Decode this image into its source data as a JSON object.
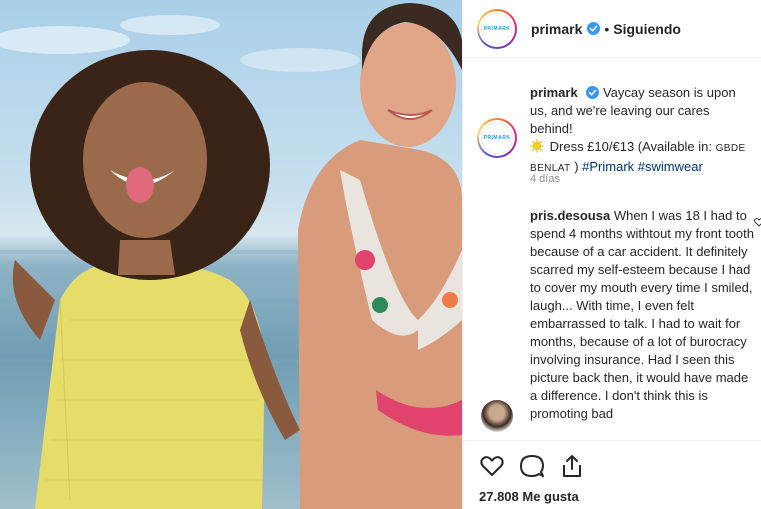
{
  "post": {
    "photo_alt": "",
    "header": {
      "username": "primark",
      "separator": "•",
      "follow_status": "Siguiendo",
      "avatar_text": "PRIMARK"
    },
    "caption": {
      "username": "primark",
      "text_1": "Vaycay season is upon us, and we're leaving our cares behind!",
      "text_2": "Dress £10/€13 (Available in:",
      "countries": "GBDE BENLAT",
      "hashtag_1": "#Primark",
      "hashtag_2": "#swimwear"
    },
    "timestamp": "4 días",
    "comment": {
      "username": "pris.desousa",
      "text": "When I was 18 I had to spend 4 months withtout my front tooth because of a car accident. It definitely scarred my self-esteem because I had to cover my mouth every time I smiled, laugh... With time, I even felt embarrassed to talk. I had to wait for months, because of a lot of burocracy involving insurance. Had I seen this picture back then, it would have made a difference. I don't think this is promoting bad"
    },
    "likes": "27.808 Me gusta",
    "icons": {
      "verified": "verified-badge-icon",
      "sun": "sun-emoji-icon",
      "like": "heart-icon",
      "comment": "comment-icon",
      "share": "share-icon"
    },
    "colors": {
      "verified": "#3897f0",
      "link": "#003569",
      "muted": "#8e8e8e"
    }
  }
}
